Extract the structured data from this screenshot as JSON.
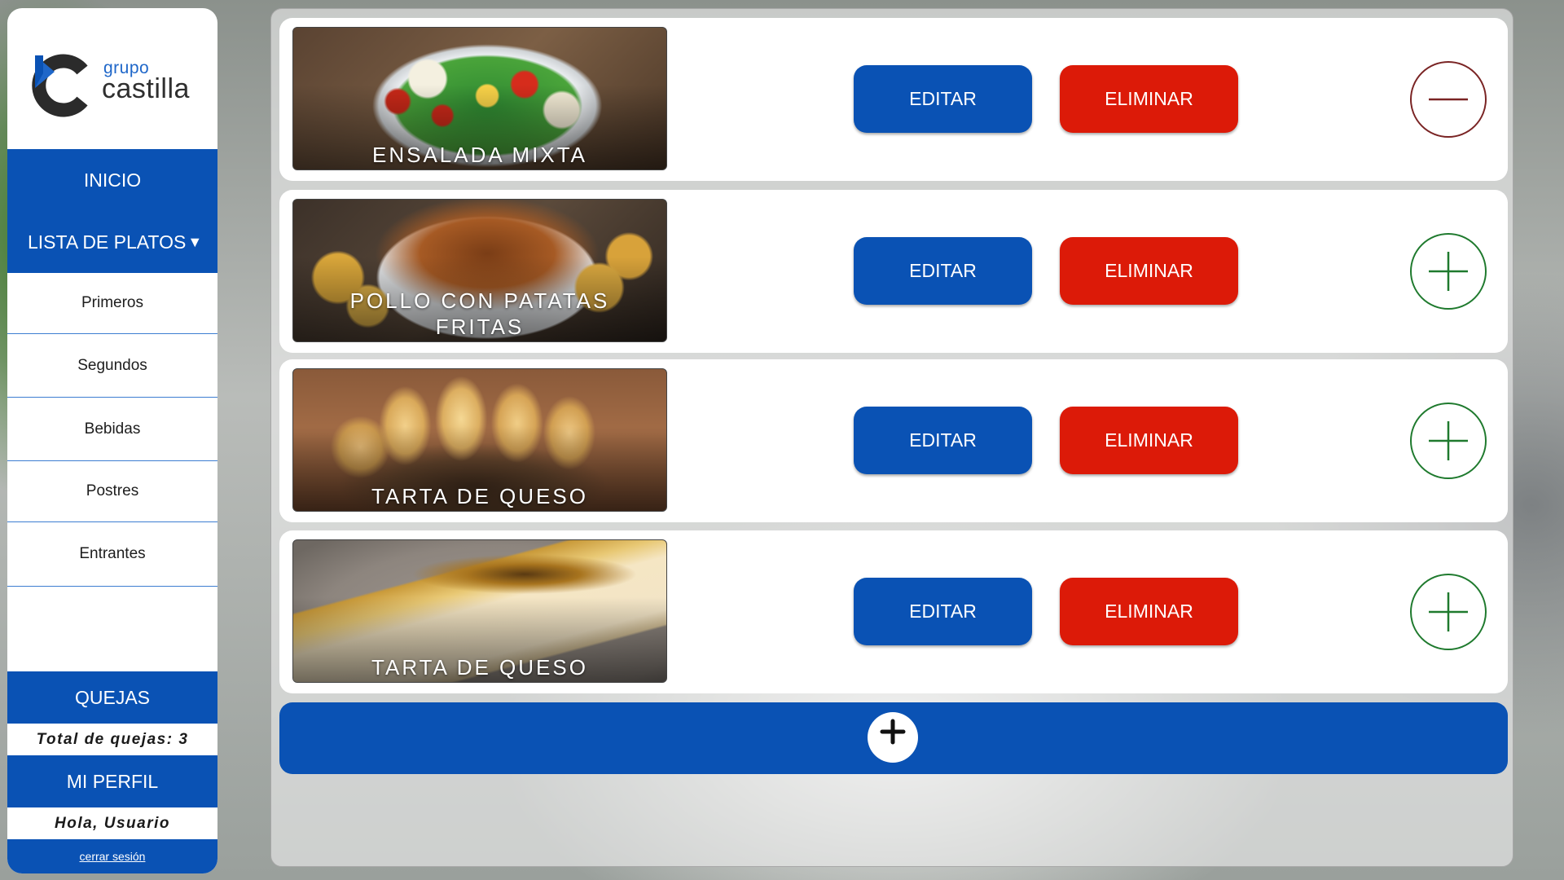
{
  "brand": {
    "line1": "grupo",
    "line2": "castilla"
  },
  "nav": {
    "inicio": "INICIO",
    "lista_platos": "LISTA DE PLATOS",
    "categories": [
      "Primeros",
      "Segundos",
      "Bebidas",
      "Postres",
      "Entrantes"
    ],
    "quejas": "QUEJAS",
    "quejas_total": "Total de quejas: 3",
    "mi_perfil": "MI PERFIL",
    "saludo": "Hola, Usuario",
    "logout": "cerrar sesión"
  },
  "dishes": [
    {
      "name": "ENSALADA MIXTA",
      "edit_label": "EDITAR",
      "delete_label": "ELIMINAR",
      "toggle": "minus-circle-icon"
    },
    {
      "name": "POLLO CON PATATAS FRITAS",
      "edit_label": "EDITAR",
      "delete_label": "ELIMINAR",
      "toggle": "plus-circle-icon"
    },
    {
      "name": "TARTA DE QUESO",
      "edit_label": "EDITAR",
      "delete_label": "ELIMINAR",
      "toggle": "plus-circle-icon"
    },
    {
      "name": "TARTA DE QUESO",
      "edit_label": "EDITAR",
      "delete_label": "ELIMINAR",
      "toggle": "plus-circle-icon"
    }
  ],
  "colors": {
    "primary_blue": "#0a52b4",
    "delete_red": "#dc1a08",
    "remove_maroon": "#7a2424",
    "add_green": "#1f7a2e"
  },
  "add_button_icon": "plus-icon"
}
